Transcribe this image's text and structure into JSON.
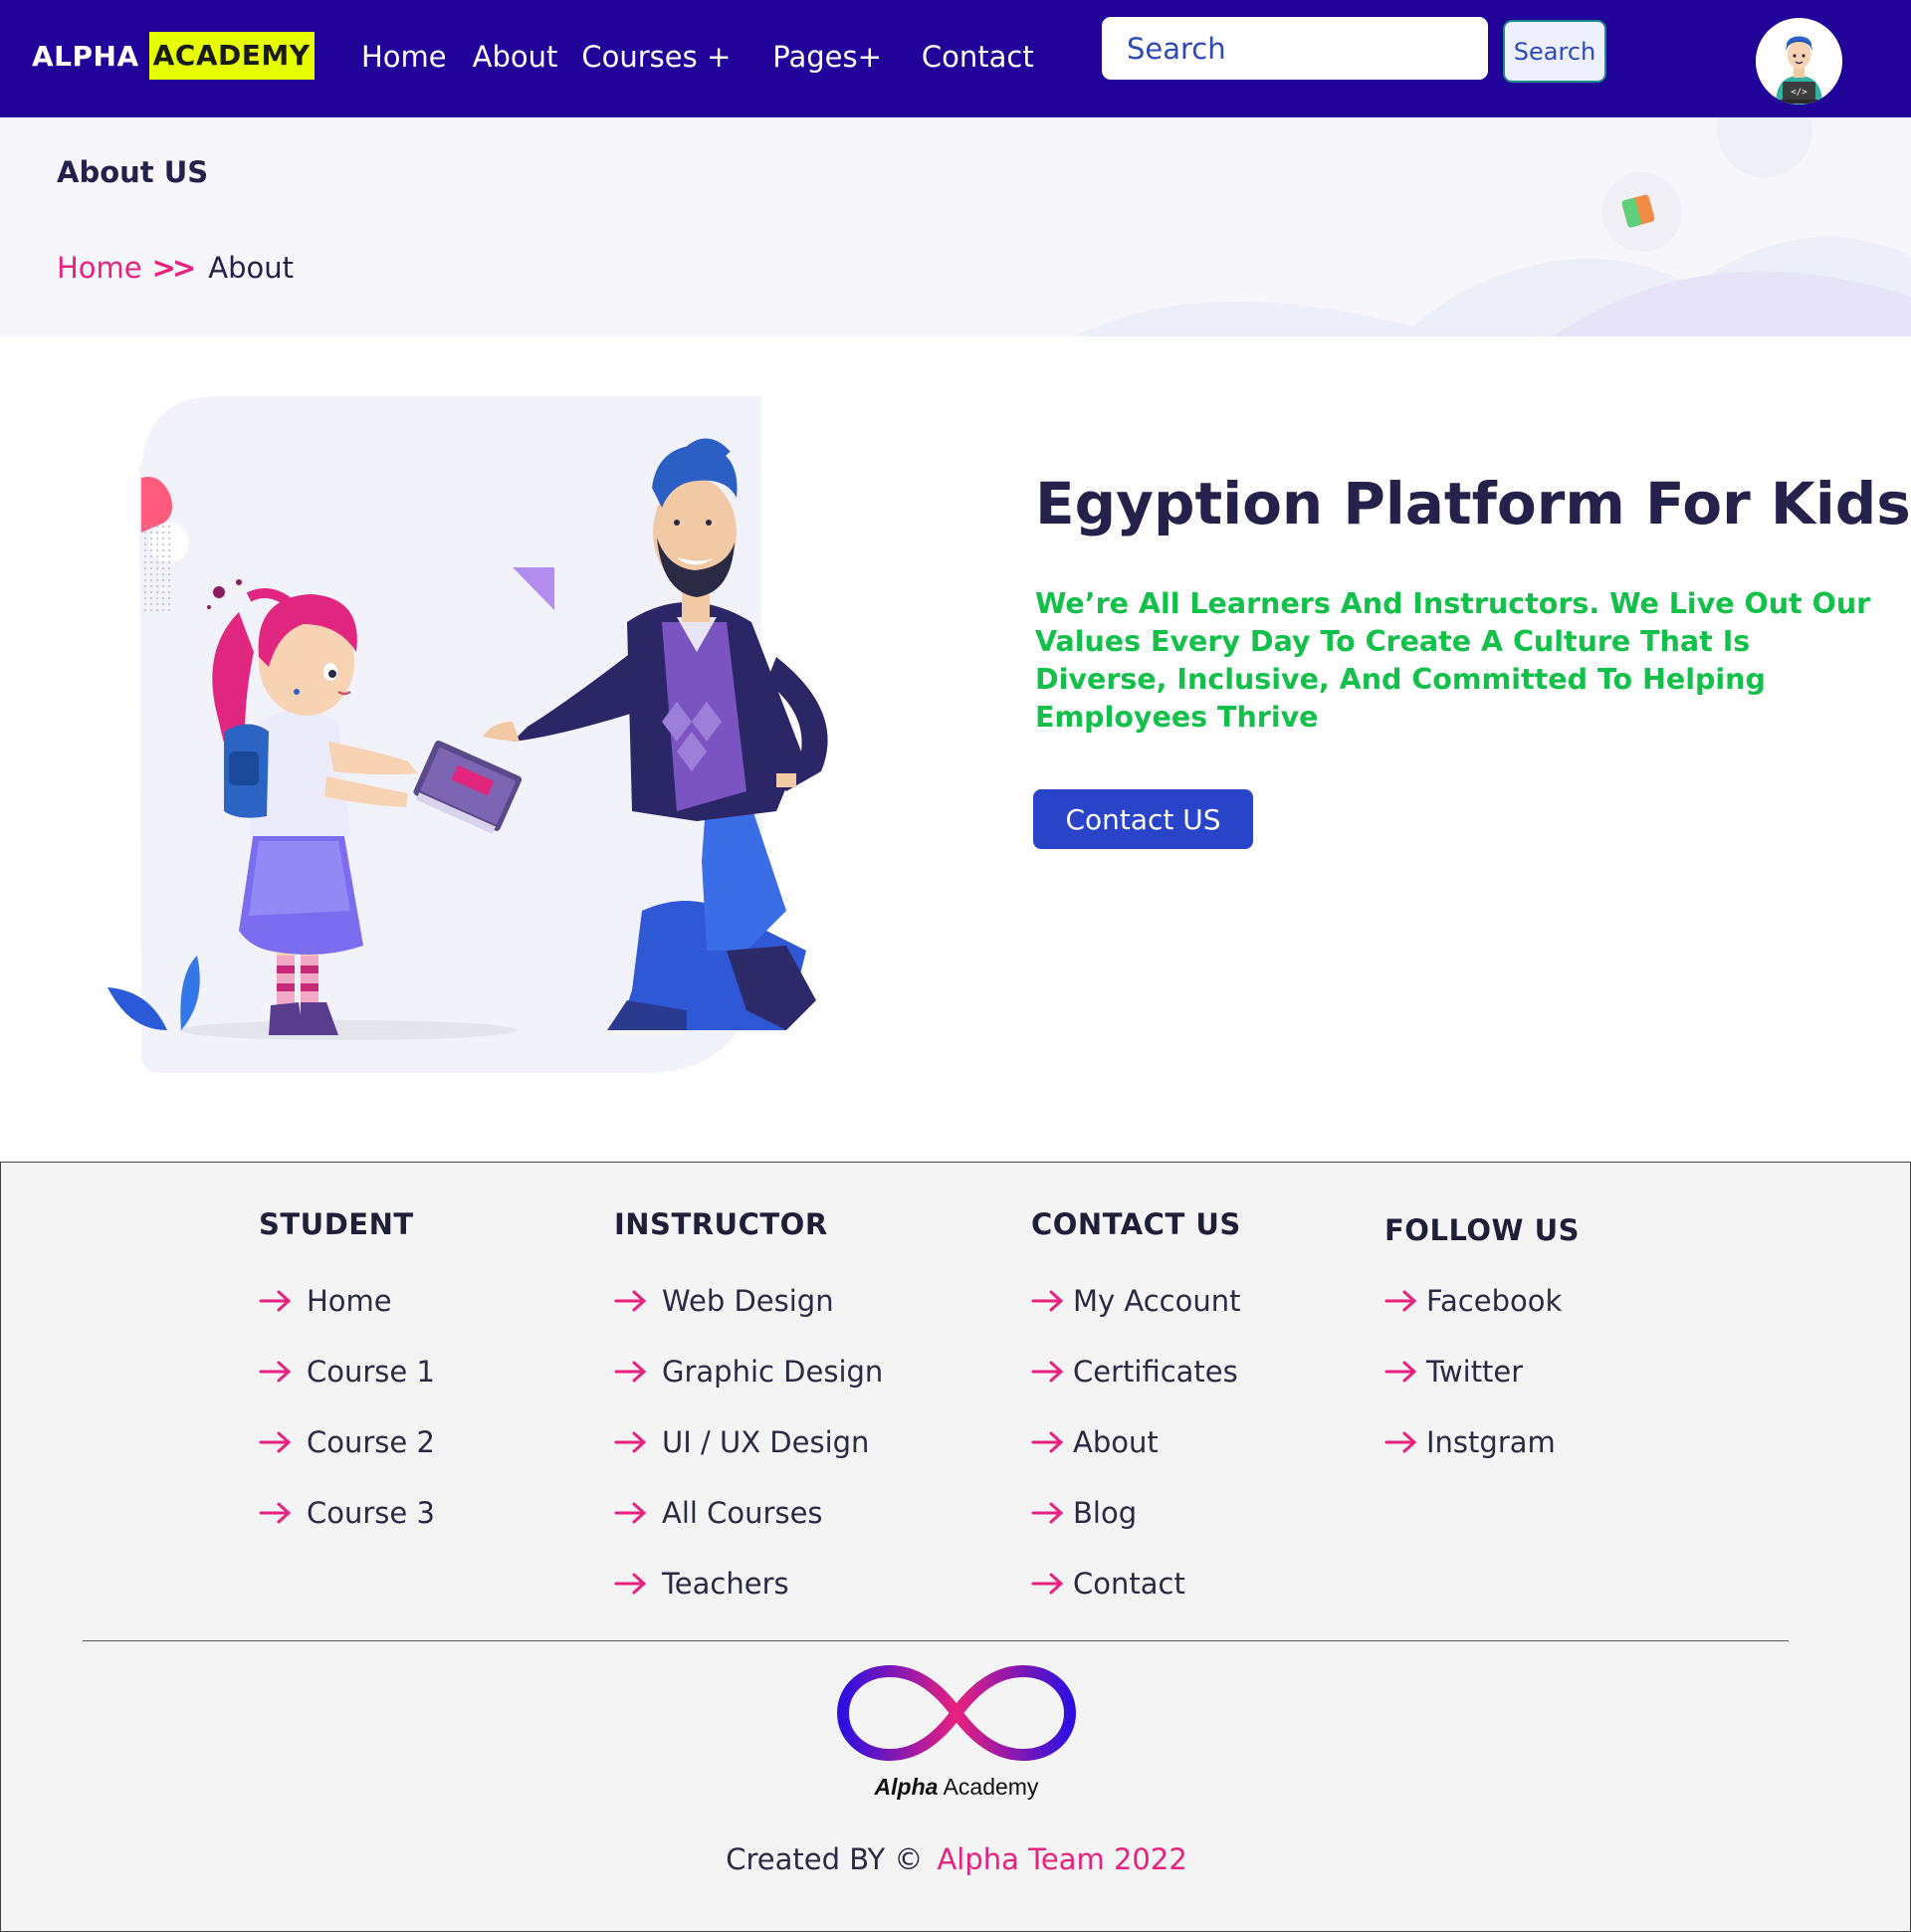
{
  "navbar": {
    "brand_part1": "ALPHA",
    "brand_part2": "ACADEMY",
    "links": [
      "Home",
      "About",
      "Courses +",
      "Pages+",
      "Contact"
    ],
    "search_placeholder": "Search",
    "search_button": "Search"
  },
  "banner": {
    "title": "About US",
    "breadcrumb_home": "Home",
    "breadcrumb_separator": ">>",
    "breadcrumb_current": "About"
  },
  "about": {
    "heading": "Egyption Platform For Kids",
    "text": "We’re All Learners And Instructors. We Live Out Our Values Every Day To Create A Culture That Is Diverse, Inclusive, And Committed To Helping Employees Thrive",
    "button": "Contact US"
  },
  "footer": {
    "columns": [
      {
        "title": "STUDENT",
        "items": [
          "Home",
          "Course 1",
          "Course 2",
          "Course 3"
        ]
      },
      {
        "title": "INSTRUCTOR",
        "items": [
          "Web Design",
          "Graphic Design",
          "UI / UX Design",
          "All Courses",
          "Teachers"
        ]
      },
      {
        "title": "CONTACT US",
        "items": [
          "My Account",
          "Certificates",
          "About",
          "Blog",
          "Contact"
        ]
      },
      {
        "title": "FOLLOW US",
        "items": [
          "Facebook",
          "Twitter",
          "Instgram"
        ]
      }
    ],
    "logo_text_bold": "Alpha",
    "logo_text_rest": " Academy",
    "credit_prefix": "Created BY ©",
    "credit_team": "Alpha Team 2022"
  },
  "colors": {
    "navbar_bg": "#22039a",
    "brand_highlight": "#e6ff00",
    "accent_pink": "#e8217e",
    "accent_green": "#13c04a",
    "button_blue": "#2a44c9"
  },
  "icons": [
    "user-avatar-icon",
    "breadcrumb-chevrons-icon",
    "arrow-right-icon",
    "infinity-logo-icon"
  ]
}
